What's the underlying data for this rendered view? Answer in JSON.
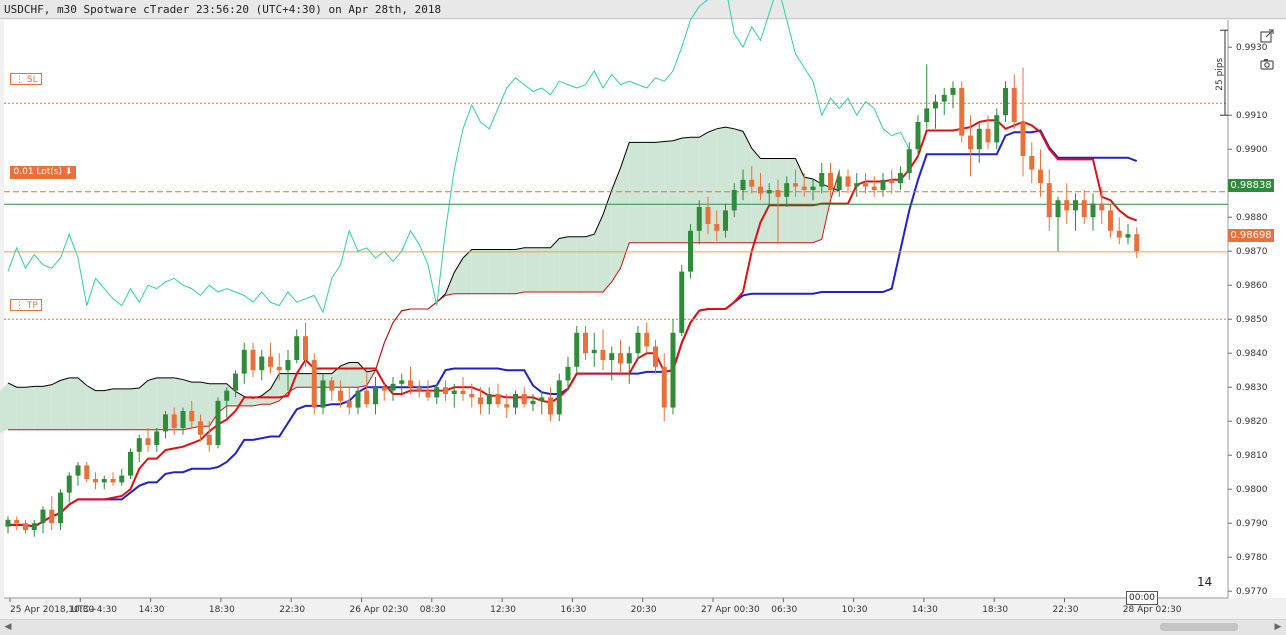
{
  "title": "USDCHF, m30 Spotware cTrader 23:56:20 (UTC+4:30) on Apr 28th, 2018",
  "colors": {
    "up": "#2e8b3a",
    "down": "#e8703a",
    "kijun": "#2020cc",
    "tenkan": "#dd1111",
    "chikou": "#2ecfa8",
    "spanA": "#000000",
    "spanB": "#cc1111",
    "cloud_bull": "#cfe6d6",
    "cloud_bear": "#f5cccc",
    "sl": "#e8703a",
    "tp": "#e8703a"
  },
  "order": {
    "sl_label": "SL",
    "tp_label": "TP",
    "lot_label": "0.01 Lot(s) ⬇"
  },
  "price_labels": {
    "current_green": "0.98838",
    "current_orange": "0.98698"
  },
  "pips_label": "25 pips",
  "right_counter": "14",
  "time_cursor": "00:00",
  "chart_data": {
    "type": "candlestick",
    "y_ticks": [
      "0.9930",
      "0.9910",
      "0.9900",
      "0.9890",
      "0.9880",
      "0.9870",
      "0.9860",
      "0.9850",
      "0.9840",
      "0.9830",
      "0.9820",
      "0.9810",
      "0.9800",
      "0.9790",
      "0.9780",
      "0.9770"
    ],
    "x_ticks": [
      "25 Apr 2018, UTC+4:30",
      "10:30",
      "14:30",
      "18:30",
      "22:30",
      "26 Apr 02:30",
      "08:30",
      "12:30",
      "16:30",
      "20:30",
      "27 Apr 00:30",
      "06:30",
      "10:30",
      "14:30",
      "18:30",
      "22:30",
      "28 Apr 02:30"
    ],
    "ylim": [
      0.9768,
      0.9938
    ],
    "levels": {
      "sl": 0.99135,
      "lot": 0.98875,
      "current_green": 0.98838,
      "current_orange": 0.98698,
      "tp": 0.985
    },
    "ohlc": [
      [
        0.9789,
        0.9792,
        0.9787,
        0.9791
      ],
      [
        0.9791,
        0.9792,
        0.9788,
        0.979
      ],
      [
        0.979,
        0.9791,
        0.9787,
        0.9788
      ],
      [
        0.9788,
        0.9791,
        0.9786,
        0.979
      ],
      [
        0.979,
        0.9795,
        0.9787,
        0.9794
      ],
      [
        0.9794,
        0.9798,
        0.9788,
        0.979
      ],
      [
        0.979,
        0.98,
        0.9788,
        0.9799
      ],
      [
        0.9799,
        0.9805,
        0.9796,
        0.9804
      ],
      [
        0.9804,
        0.9808,
        0.9801,
        0.9807
      ],
      [
        0.9807,
        0.9808,
        0.9802,
        0.9803
      ],
      [
        0.9803,
        0.9805,
        0.98,
        0.9802
      ],
      [
        0.9802,
        0.9804,
        0.98,
        0.9803
      ],
      [
        0.9803,
        0.9805,
        0.9801,
        0.9802
      ],
      [
        0.9802,
        0.9806,
        0.9801,
        0.9804
      ],
      [
        0.9804,
        0.9812,
        0.9803,
        0.9811
      ],
      [
        0.9811,
        0.9816,
        0.9808,
        0.9815
      ],
      [
        0.9815,
        0.9818,
        0.9811,
        0.9813
      ],
      [
        0.9813,
        0.9818,
        0.9811,
        0.9817
      ],
      [
        0.9817,
        0.9823,
        0.9815,
        0.9822
      ],
      [
        0.9822,
        0.9824,
        0.9816,
        0.9818
      ],
      [
        0.9818,
        0.9824,
        0.9816,
        0.9823
      ],
      [
        0.9823,
        0.9826,
        0.9818,
        0.982
      ],
      [
        0.982,
        0.9822,
        0.9814,
        0.9816
      ],
      [
        0.9816,
        0.982,
        0.9811,
        0.9813
      ],
      [
        0.9813,
        0.9827,
        0.9812,
        0.9826
      ],
      [
        0.9826,
        0.983,
        0.9821,
        0.9829
      ],
      [
        0.9829,
        0.9835,
        0.9827,
        0.9834
      ],
      [
        0.9834,
        0.9843,
        0.9831,
        0.9841
      ],
      [
        0.9841,
        0.9843,
        0.9833,
        0.9835
      ],
      [
        0.9835,
        0.9841,
        0.9832,
        0.9839
      ],
      [
        0.9839,
        0.9843,
        0.9834,
        0.9836
      ],
      [
        0.9836,
        0.984,
        0.9832,
        0.9835
      ],
      [
        0.9835,
        0.9841,
        0.9829,
        0.9838
      ],
      [
        0.9838,
        0.9847,
        0.9837,
        0.9845
      ],
      [
        0.9845,
        0.9849,
        0.9836,
        0.9838
      ],
      [
        0.9838,
        0.984,
        0.9822,
        0.9824
      ],
      [
        0.9824,
        0.9834,
        0.9822,
        0.9832
      ],
      [
        0.9832,
        0.9833,
        0.9826,
        0.9829
      ],
      [
        0.9829,
        0.9832,
        0.9824,
        0.9826
      ],
      [
        0.9826,
        0.983,
        0.9822,
        0.9824
      ],
      [
        0.9824,
        0.983,
        0.9822,
        0.9829
      ],
      [
        0.9829,
        0.9834,
        0.9824,
        0.9825
      ],
      [
        0.9825,
        0.9833,
        0.9822,
        0.983
      ],
      [
        0.983,
        0.9831,
        0.9826,
        0.9829
      ],
      [
        0.9829,
        0.9833,
        0.9826,
        0.9831
      ],
      [
        0.9831,
        0.9834,
        0.9828,
        0.9832
      ],
      [
        0.9832,
        0.9836,
        0.9828,
        0.983
      ],
      [
        0.983,
        0.9832,
        0.9827,
        0.9829
      ],
      [
        0.9829,
        0.9832,
        0.9826,
        0.9827
      ],
      [
        0.9827,
        0.9831,
        0.9825,
        0.983
      ],
      [
        0.983,
        0.9832,
        0.9826,
        0.9828
      ],
      [
        0.9828,
        0.9831,
        0.9824,
        0.9829
      ],
      [
        0.9829,
        0.9833,
        0.9826,
        0.9828
      ],
      [
        0.9828,
        0.9831,
        0.9824,
        0.9827
      ],
      [
        0.9827,
        0.983,
        0.9822,
        0.9825
      ],
      [
        0.9825,
        0.983,
        0.9822,
        0.9828
      ],
      [
        0.9828,
        0.9831,
        0.9824,
        0.9825
      ],
      [
        0.9825,
        0.9828,
        0.9821,
        0.9824
      ],
      [
        0.9824,
        0.9829,
        0.9822,
        0.9828
      ],
      [
        0.9828,
        0.983,
        0.9824,
        0.9825
      ],
      [
        0.9825,
        0.9828,
        0.9823,
        0.9826
      ],
      [
        0.9826,
        0.9829,
        0.9822,
        0.9827
      ],
      [
        0.9827,
        0.983,
        0.982,
        0.9822
      ],
      [
        0.9822,
        0.9834,
        0.982,
        0.9832
      ],
      [
        0.9832,
        0.9839,
        0.9829,
        0.9836
      ],
      [
        0.9836,
        0.9848,
        0.9834,
        0.9846
      ],
      [
        0.9846,
        0.9848,
        0.9838,
        0.984
      ],
      [
        0.984,
        0.9846,
        0.9836,
        0.9841
      ],
      [
        0.9841,
        0.9847,
        0.9835,
        0.9838
      ],
      [
        0.9838,
        0.9842,
        0.9832,
        0.984
      ],
      [
        0.984,
        0.9844,
        0.9834,
        0.9837
      ],
      [
        0.9837,
        0.9842,
        0.9831,
        0.984
      ],
      [
        0.984,
        0.9848,
        0.9838,
        0.9846
      ],
      [
        0.9846,
        0.9849,
        0.984,
        0.9842
      ],
      [
        0.9842,
        0.9844,
        0.9834,
        0.9836
      ],
      [
        0.9836,
        0.984,
        0.982,
        0.9824
      ],
      [
        0.9824,
        0.985,
        0.9822,
        0.9846
      ],
      [
        0.9846,
        0.9866,
        0.9845,
        0.9864
      ],
      [
        0.9864,
        0.9878,
        0.9862,
        0.9876
      ],
      [
        0.9876,
        0.9885,
        0.9872,
        0.9883
      ],
      [
        0.9883,
        0.9886,
        0.9875,
        0.9878
      ],
      [
        0.9878,
        0.9882,
        0.9873,
        0.9876
      ],
      [
        0.9876,
        0.9884,
        0.9874,
        0.9882
      ],
      [
        0.9882,
        0.989,
        0.988,
        0.9888
      ],
      [
        0.9888,
        0.9894,
        0.9885,
        0.9891
      ],
      [
        0.9891,
        0.9895,
        0.9887,
        0.9889
      ],
      [
        0.9889,
        0.9893,
        0.9885,
        0.9887
      ],
      [
        0.9887,
        0.989,
        0.9883,
        0.9888
      ],
      [
        0.9888,
        0.9891,
        0.9872,
        0.9886
      ],
      [
        0.9886,
        0.9892,
        0.9883,
        0.989
      ],
      [
        0.989,
        0.9894,
        0.9886,
        0.9889
      ],
      [
        0.9889,
        0.9893,
        0.9886,
        0.9888
      ],
      [
        0.9888,
        0.9891,
        0.9885,
        0.9889
      ],
      [
        0.9889,
        0.9896,
        0.9887,
        0.9893
      ],
      [
        0.9893,
        0.9896,
        0.9886,
        0.9888
      ],
      [
        0.9888,
        0.9894,
        0.9886,
        0.9892
      ],
      [
        0.9892,
        0.9894,
        0.9887,
        0.9889
      ],
      [
        0.9889,
        0.9893,
        0.9886,
        0.989
      ],
      [
        0.989,
        0.9893,
        0.9887,
        0.9889
      ],
      [
        0.9889,
        0.9892,
        0.9886,
        0.9888
      ],
      [
        0.9888,
        0.9893,
        0.9886,
        0.9891
      ],
      [
        0.9891,
        0.9894,
        0.9887,
        0.989
      ],
      [
        0.989,
        0.9895,
        0.9888,
        0.9893
      ],
      [
        0.9893,
        0.9902,
        0.9891,
        0.99
      ],
      [
        0.99,
        0.991,
        0.9898,
        0.9908
      ],
      [
        0.9908,
        0.9925,
        0.9906,
        0.9912
      ],
      [
        0.9912,
        0.9916,
        0.9906,
        0.9914
      ],
      [
        0.9914,
        0.9918,
        0.991,
        0.9916
      ],
      [
        0.9916,
        0.992,
        0.9912,
        0.9918
      ],
      [
        0.9918,
        0.992,
        0.9902,
        0.9904
      ],
      [
        0.9904,
        0.991,
        0.9892,
        0.99
      ],
      [
        0.99,
        0.9908,
        0.9896,
        0.9906
      ],
      [
        0.9906,
        0.991,
        0.99,
        0.9902
      ],
      [
        0.9902,
        0.9912,
        0.99,
        0.991
      ],
      [
        0.991,
        0.992,
        0.9908,
        0.9918
      ],
      [
        0.9918,
        0.9922,
        0.9906,
        0.9908
      ],
      [
        0.9908,
        0.9924,
        0.9892,
        0.9898
      ],
      [
        0.9898,
        0.9902,
        0.989,
        0.9894
      ],
      [
        0.9894,
        0.99,
        0.9886,
        0.989
      ],
      [
        0.989,
        0.9894,
        0.9876,
        0.988
      ],
      [
        0.988,
        0.9886,
        0.987,
        0.9885
      ],
      [
        0.9885,
        0.989,
        0.9878,
        0.9882
      ],
      [
        0.9882,
        0.9887,
        0.9876,
        0.9885
      ],
      [
        0.9885,
        0.9888,
        0.9878,
        0.988
      ],
      [
        0.988,
        0.9887,
        0.9876,
        0.9884
      ],
      [
        0.9884,
        0.9889,
        0.9878,
        0.9882
      ],
      [
        0.9882,
        0.9884,
        0.9874,
        0.9876
      ],
      [
        0.9876,
        0.988,
        0.9872,
        0.9874
      ],
      [
        0.9874,
        0.9878,
        0.9872,
        0.9875
      ],
      [
        0.9875,
        0.9877,
        0.9868,
        0.987
      ]
    ]
  }
}
